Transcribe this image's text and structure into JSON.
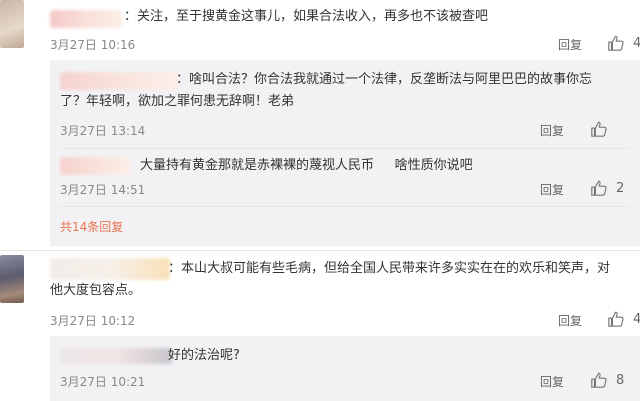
{
  "comments": [
    {
      "text": "：关注，至于搜黄金这事儿，如果合法收入，再多也不该被查吧",
      "time": "3月27日 10:16",
      "reply": "回复",
      "likes": "4",
      "replies": [
        {
          "text_line1": "：啥叫合法？你合法我就通过一个法律，反垄断法与阿里巴巴的故事你忘",
          "text_line2": "了？年轻啊，欲加之罪何患无辞啊！老弟",
          "time": "3月27日 13:14",
          "reply": "回复",
          "likes": ""
        },
        {
          "text": "大量持有黄金那就是赤裸裸的蔑视人民币     啥性质你说吧",
          "time": "3月27日 14:51",
          "reply": "回复",
          "likes": "2"
        }
      ],
      "more": "共14条回复"
    },
    {
      "text_line1": "：本山大叔可能有些毛病，但给全国人民带来许多实实在在的欢乐和笑声，对",
      "text_line2": "他大度包容点。",
      "time": "3月27日 10:12",
      "reply": "回复",
      "likes": "4",
      "replies": [
        {
          "text": "好的法治呢?",
          "time": "3月27日 10:21",
          "reply": "回复",
          "likes": "8"
        }
      ]
    }
  ],
  "icons": {
    "like": "thumbs-up-icon"
  },
  "colors": {
    "nested_bg": "#f2f2f5",
    "more_link": "#eb7350",
    "meta": "#888888"
  }
}
